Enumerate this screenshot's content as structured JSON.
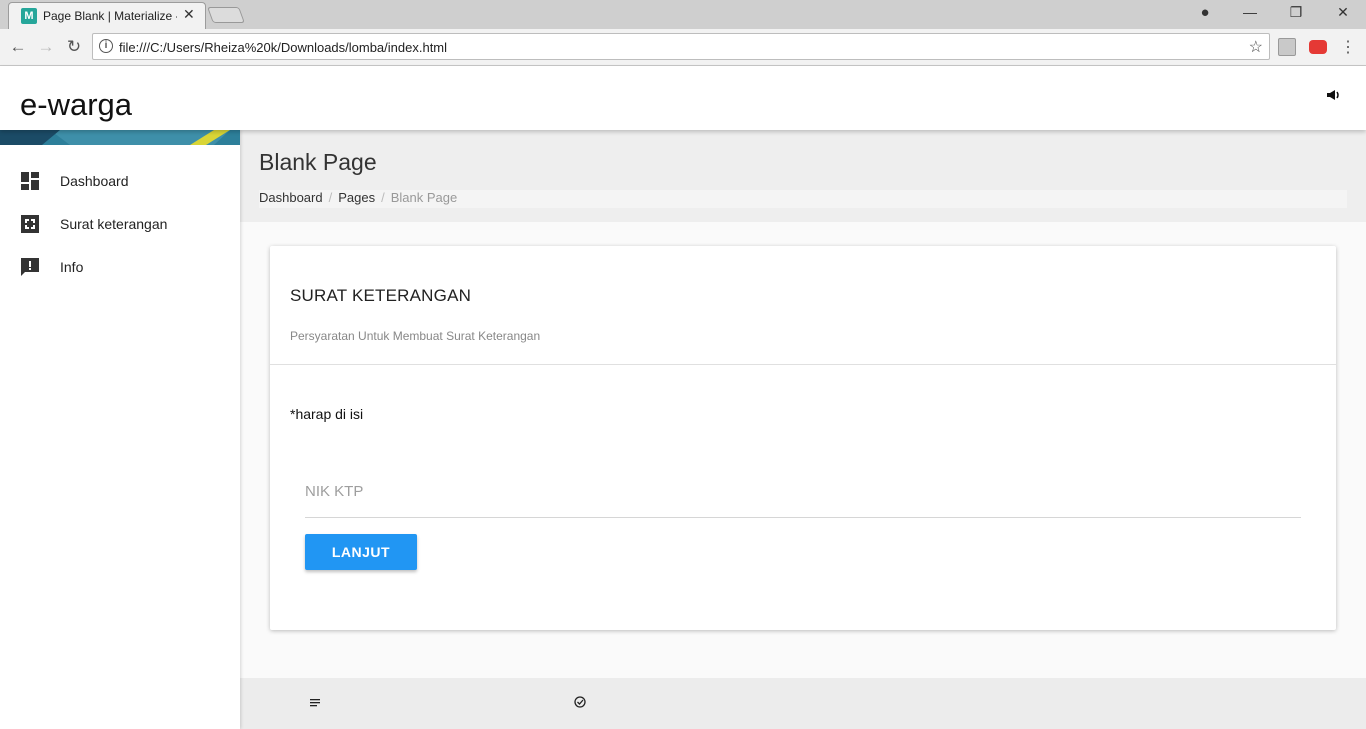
{
  "browser": {
    "tab_title": "Page Blank | Materialize -",
    "favicon_letter": "M",
    "tab_close": "✕",
    "url": "file:///C:/Users/Rheiza%20k/Downloads/lomba/index.html",
    "win_account": "●",
    "win_minimize": "—",
    "win_restore": "❐",
    "win_close": "✕",
    "back": "←",
    "forward": "→",
    "reload": "↻",
    "info": "i",
    "star": "☆",
    "menu": "⋮"
  },
  "app": {
    "brand": "e-warga",
    "speaker_icon": "📢"
  },
  "sidebar": {
    "items": [
      {
        "label": "Dashboard",
        "icon": "dashboard-icon"
      },
      {
        "label": "Surat keterangan",
        "icon": "fullscreen-icon"
      },
      {
        "label": "Info",
        "icon": "feedback-icon"
      }
    ]
  },
  "page": {
    "title": "Blank Page",
    "breadcrumb": [
      "Dashboard",
      "Pages",
      "Blank Page"
    ],
    "breadcrumb_sep": "/"
  },
  "card": {
    "title": "SURAT KETERANGAN",
    "subtitle": "Persyaratan Untuk Membuat Surat Keterangan",
    "note": "*harap di isi",
    "nik_placeholder": "NIK KTP",
    "nik_value": "",
    "button": "LANJUT"
  },
  "colors": {
    "primary_button": "#2196f3",
    "header_bg": "#eeeeee"
  }
}
